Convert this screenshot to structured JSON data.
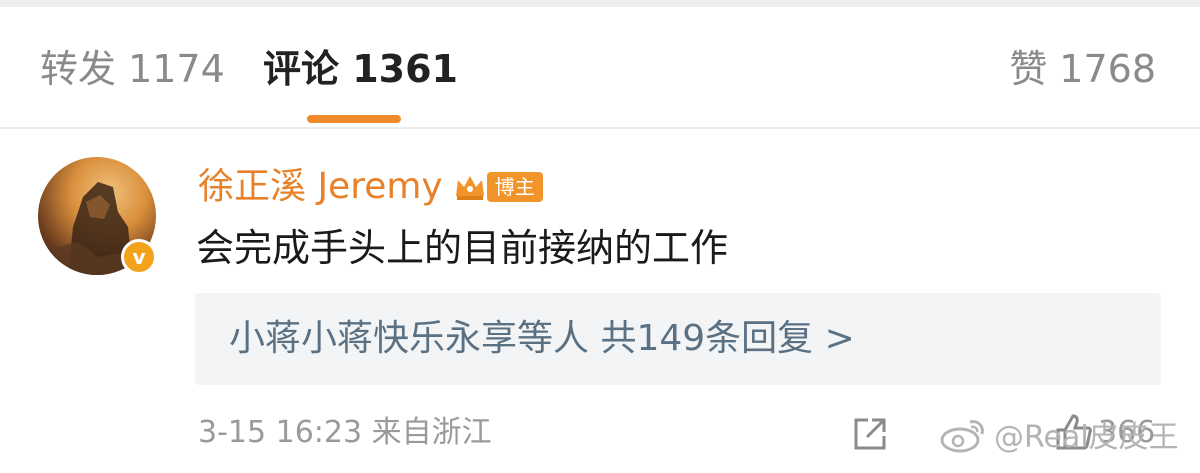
{
  "tabs": {
    "repost": "转发 1174",
    "comments": "评论 1361",
    "likes": "赞 1768"
  },
  "comment": {
    "username": "徐正溪 Jeremy",
    "badge_label": "博主",
    "verified_mark": "v",
    "text": "会完成手头上的目前接纳的工作",
    "replies_summary": "小蒋小蒋快乐永享等人  共149条回复 >",
    "time_location": "3-15 16:23  来自浙江",
    "like_count": "366"
  },
  "watermark": {
    "text": "@Real皮皮王"
  },
  "colors": {
    "accent": "#f08a2a",
    "username": "#e8822a",
    "reply_link": "#5a7184",
    "meta": "#9a9a9a",
    "reply_bg": "#f3f4f6"
  },
  "icons": {
    "verified": "verified-badge-icon",
    "crown": "crown-icon",
    "share": "share-icon",
    "weibo": "weibo-logo-icon",
    "like": "thumbs-up-icon"
  }
}
